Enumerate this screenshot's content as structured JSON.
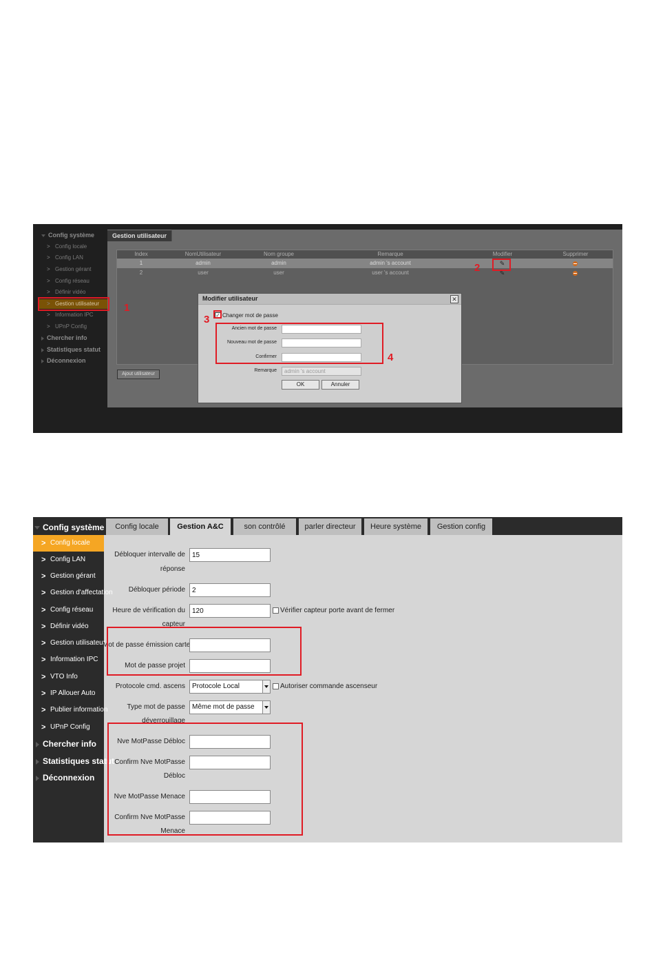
{
  "screenshot1": {
    "sidebar": {
      "config_systeme": "Config système",
      "items": [
        "Config locale",
        "Config LAN",
        "Gestion gérant",
        "Config réseau",
        "Définir vidéo",
        "Gestion utilisateur",
        "Information IPC",
        "UPnP Config"
      ],
      "selected_index": 5,
      "chercher_info": "Chercher info",
      "statistiques_statut": "Statistiques statut",
      "deconnexion": "Déconnexion"
    },
    "tab_label": "Gestion utilisateur",
    "table": {
      "columns": [
        "Index",
        "NomUtilisateur",
        "Nom groupe",
        "Remarque",
        "Modifier",
        "Supprimer"
      ],
      "rows": [
        {
          "index": "1",
          "user": "admin",
          "group": "admin",
          "remark": "admin 's account"
        },
        {
          "index": "2",
          "user": "user",
          "group": "user",
          "remark": "user 's account"
        }
      ]
    },
    "add_user_button": "Ajout utilisateur",
    "dialog": {
      "title": "Modifier utilisateur",
      "change_password_label": "Changer mot de passe",
      "change_password_checked": true,
      "old_password_label": "Ancien mot de passe",
      "new_password_label": "Nouveau mot de passe",
      "confirm_label": "Confirmer",
      "remark_label": "Remarque",
      "remark_value": "admin 's account",
      "ok_button": "OK",
      "cancel_button": "Annuler"
    },
    "callouts": [
      "1",
      "2",
      "3",
      "4"
    ],
    "callout_color": "#e01b24"
  },
  "screenshot2": {
    "sidebar": {
      "config_systeme": "Config système",
      "items": [
        "Config locale",
        "Config LAN",
        "Gestion gérant",
        "Gestion d'affectation",
        "Config réseau",
        "Définir vidéo",
        "Gestion utilisateur",
        "Information IPC",
        "VTO Info",
        "IP Allouer Auto",
        "Publier information",
        "UPnP Config"
      ],
      "selected_index": 0,
      "chercher_info": "Chercher info",
      "statistiques_statut": "Statistiques statut",
      "deconnexion": "Déconnexion"
    },
    "tabs": [
      "Config locale",
      "Gestion A&C",
      "son contrôlé",
      "parler directeur",
      "Heure système",
      "Gestion config"
    ],
    "active_tab_index": 1,
    "form": {
      "unlock_interval_label_1": "Débloquer intervalle de",
      "unlock_interval_label_2": "réponse",
      "unlock_interval_value": "15",
      "unlock_period_label": "Débloquer période",
      "unlock_period_value": "2",
      "check_time_label_1": "Heure de vérification du",
      "check_time_label_2": "capteur",
      "check_time_value": "120",
      "check_sensor_checkbox": "Vérifier capteur porte avant de fermer",
      "card_password_label": "Mot de passe émission carte",
      "card_password_value": "",
      "project_password_label": "Mot de passe projet",
      "project_password_value": "",
      "elevator_protocol_label": "Protocole cmd. ascens",
      "elevator_protocol_value": "Protocole Local",
      "authorize_elevator_checkbox": "Autoriser commande ascenseur",
      "unlock_password_type_label_1": "Type mot de passe",
      "unlock_password_type_label_2": "déverrouillage",
      "unlock_password_type_value": "Même mot de passe",
      "new_unlock_password_label": "Nve MotPasse Débloc",
      "confirm_new_unlock_password_label_1": "Confirm Nve MotPasse",
      "confirm_new_unlock_password_label_2": "Débloc",
      "new_duress_password_label": "Nve MotPasse Menace",
      "confirm_new_duress_password_label_1": "Confirm Nve MotPasse",
      "confirm_new_duress_password_label_2": "Menace"
    },
    "highlight_color": "#e01b24"
  }
}
